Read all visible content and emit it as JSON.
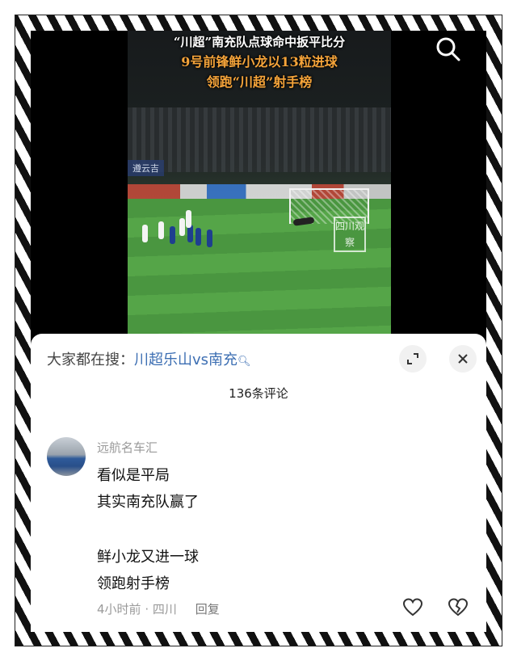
{
  "video": {
    "headline_line1": "“川超”南充队点球命中扳平比分",
    "headline_line2": "9号前锋鲜小龙以13粒进球",
    "headline_line3": "领跑“川超”射手榜",
    "watermark": "四川观察",
    "side_logo": "遵云吉",
    "search_icon": "search-icon"
  },
  "trending": {
    "prefix": "大家都在搜：",
    "keyword": "川超乐山vs南充",
    "icon": "search-icon"
  },
  "comments_count": "136条评论",
  "comment": {
    "author": "远航名车汇",
    "lines": [
      "看似是平局",
      "其实南充队赢了",
      "",
      "鲜小龙又进一球",
      "领跑射手榜"
    ],
    "time": "4小时前",
    "separator": "·",
    "location": "四川",
    "reply_label": "回复"
  },
  "icons": {
    "expand": "expand-icon",
    "close": "close-icon",
    "like": "heart-icon",
    "dislike": "broken-heart-icon"
  }
}
